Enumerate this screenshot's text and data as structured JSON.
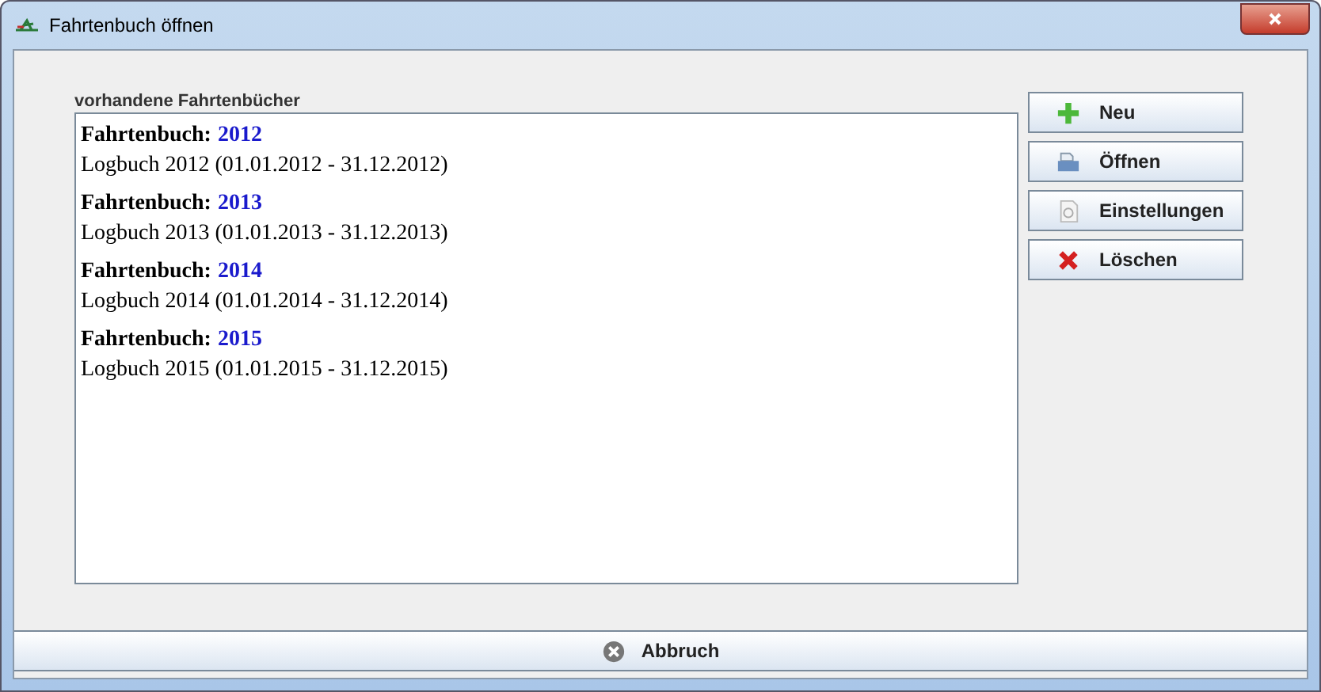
{
  "window": {
    "title": "Fahrtenbuch öffnen"
  },
  "list": {
    "label": "vorhandene Fahrtenbücher",
    "items": [
      {
        "heading": "Fahrtenbuch:",
        "year": "2012",
        "detail": "Logbuch 2012 (01.01.2012 - 31.12.2012)"
      },
      {
        "heading": "Fahrtenbuch:",
        "year": "2013",
        "detail": "Logbuch 2013 (01.01.2013 - 31.12.2013)"
      },
      {
        "heading": "Fahrtenbuch:",
        "year": "2014",
        "detail": "Logbuch 2014 (01.01.2014 - 31.12.2014)"
      },
      {
        "heading": "Fahrtenbuch:",
        "year": "2015",
        "detail": "Logbuch 2015 (01.01.2015 - 31.12.2015)"
      }
    ]
  },
  "buttons": [
    {
      "kind": "new",
      "label": "Neu"
    },
    {
      "kind": "open",
      "label": "Öffnen"
    },
    {
      "kind": "settings",
      "label": "Einstellungen"
    },
    {
      "kind": "delete",
      "label": "Löschen"
    }
  ],
  "cancel_button": {
    "label": "Abbruch"
  }
}
